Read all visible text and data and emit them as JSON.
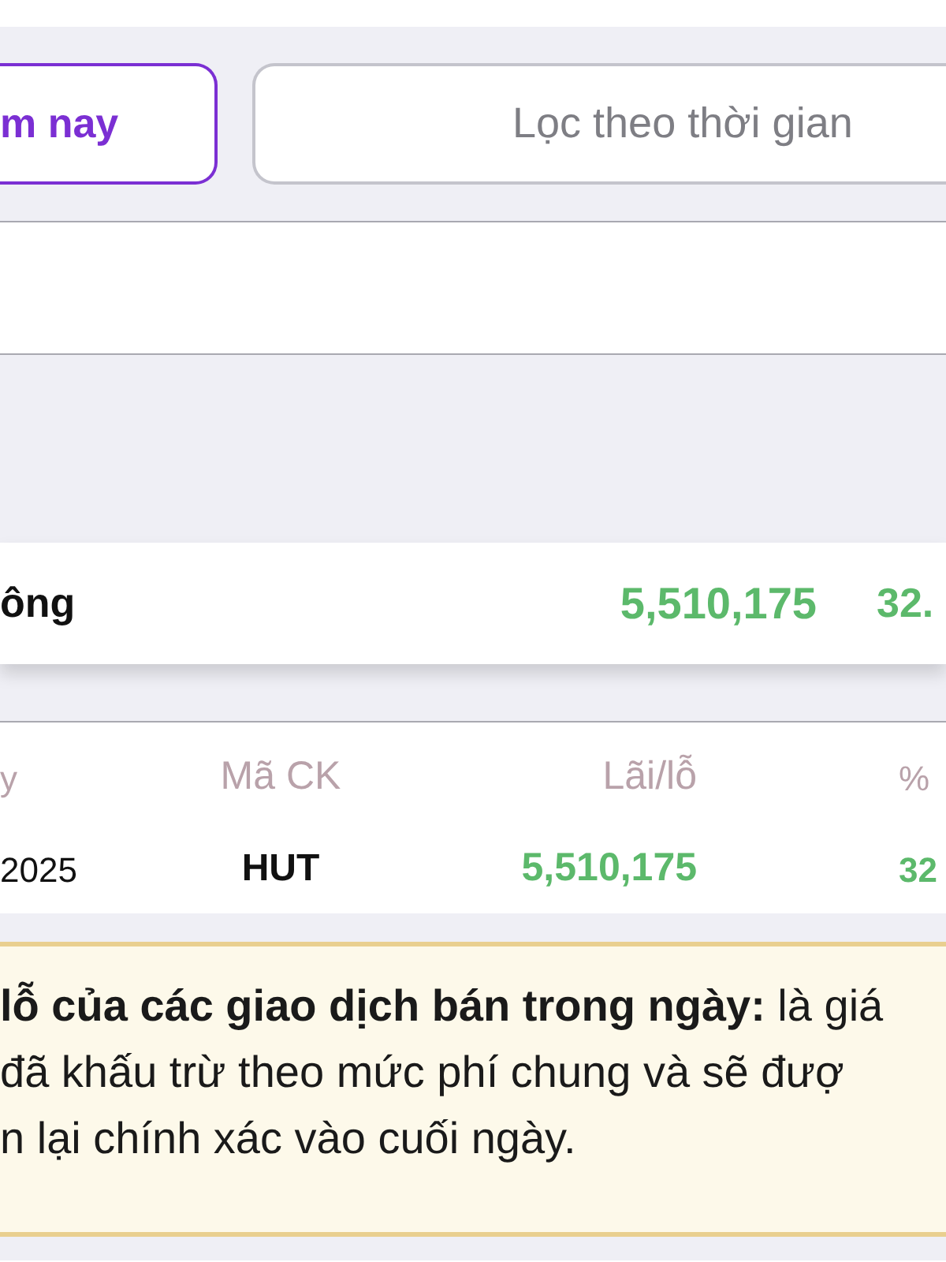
{
  "filters": [
    {
      "label": "m nay",
      "selected": true
    },
    {
      "label": "Lọc theo thời gian",
      "selected": false
    }
  ],
  "summary": {
    "label": "ông",
    "value": "5,510,175",
    "percent": "32."
  },
  "table": {
    "columns": [
      "y",
      "Mã CK",
      "Lãi/lỗ",
      "%"
    ],
    "rows": [
      [
        "2025",
        "HUT",
        "5,510,175",
        "32"
      ]
    ]
  },
  "note": {
    "lines": [
      "**lỗ của các giao dịch bán trong ngày:** là giá",
      "đã khấu trừ theo mức phí chung và sẽ đượ",
      "n lại chính xác vào cuối ngày."
    ]
  }
}
